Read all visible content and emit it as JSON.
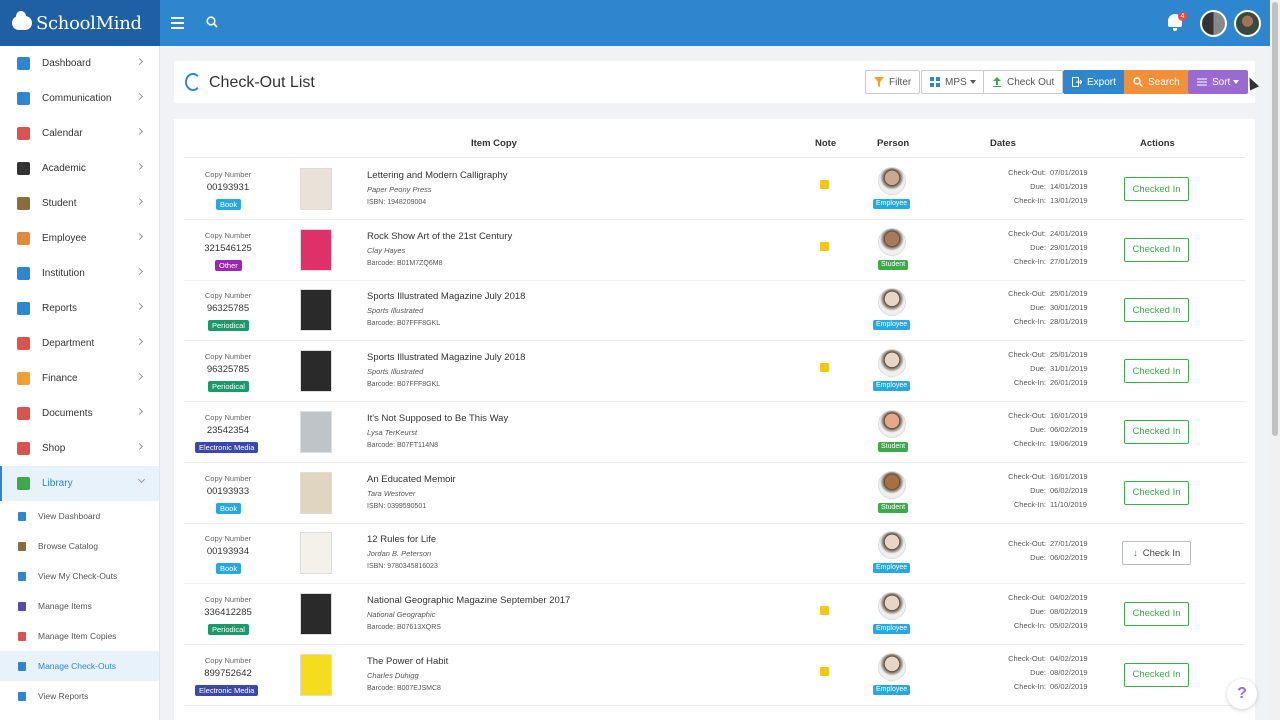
{
  "app": {
    "name": "SchoolMind",
    "notification_count": "4"
  },
  "sidebar": {
    "items": [
      {
        "label": "Dashboard",
        "icon": "dashboard-icon",
        "color": "#2e86cf"
      },
      {
        "label": "Communication",
        "icon": "chat-icon",
        "color": "#2e86cf"
      },
      {
        "label": "Calendar",
        "icon": "calendar-icon",
        "color": "#d9534f"
      },
      {
        "label": "Academic",
        "icon": "graduation-cap-icon",
        "color": "#333333"
      },
      {
        "label": "Student",
        "icon": "student-icon",
        "color": "#8a6d3b"
      },
      {
        "label": "Employee",
        "icon": "employee-icon",
        "color": "#e08a3a"
      },
      {
        "label": "Institution",
        "icon": "building-icon",
        "color": "#2e86cf"
      },
      {
        "label": "Reports",
        "icon": "report-icon",
        "color": "#2e86cf"
      },
      {
        "label": "Department",
        "icon": "department-icon",
        "color": "#d9534f"
      },
      {
        "label": "Finance",
        "icon": "finance-icon",
        "color": "#f0a030"
      },
      {
        "label": "Documents",
        "icon": "documents-icon",
        "color": "#d9534f"
      },
      {
        "label": "Shop",
        "icon": "shop-icon",
        "color": "#d9534f"
      },
      {
        "label": "Library",
        "icon": "library-icon",
        "color": "#3bab4a"
      }
    ],
    "library_sub": [
      {
        "label": "View Dashboard",
        "icon": "refresh-icon",
        "color": "#2e86cf"
      },
      {
        "label": "Browse Catalog",
        "icon": "catalog-icon",
        "color": "#8a6d3b"
      },
      {
        "label": "View My Check-Outs",
        "icon": "refresh-icon",
        "color": "#2e86cf"
      },
      {
        "label": "Manage Items",
        "icon": "book-icon",
        "color": "#5b4aa8"
      },
      {
        "label": "Manage Item Copies",
        "icon": "book-icon",
        "color": "#d9534f"
      },
      {
        "label": "Manage Check-Outs",
        "icon": "refresh-icon",
        "color": "#2e86cf"
      },
      {
        "label": "View Reports",
        "icon": "report-icon",
        "color": "#2e86cf"
      }
    ]
  },
  "header": {
    "title": "Check-Out List",
    "buttons": {
      "filter": "Filter",
      "mps": "MPS",
      "checkout": "Check Out",
      "export": "Export",
      "search": "Search",
      "sort": "Sort"
    }
  },
  "table": {
    "columns": {
      "item": "Item Copy",
      "note": "Note",
      "person": "Person",
      "dates": "Dates",
      "actions": "Actions"
    },
    "labels": {
      "copy_number": "Copy Number",
      "check_out": "Check-Out:",
      "due": "Due:",
      "check_in": "Check-In:"
    },
    "rows": [
      {
        "copy": "00193931",
        "type": "Book",
        "title": "Lettering and Modern Calligraphy",
        "sub": "Paper Peony Press",
        "code": "ISBN: 1948209004",
        "note": true,
        "role": "Employee",
        "out": "07/01/2019",
        "due": "14/01/2019",
        "in": "13/01/2019",
        "action": "Checked In"
      },
      {
        "copy": "321546125",
        "type": "Other",
        "title": "Rock Show Art of the 21st Century",
        "sub": "Clay Hayes",
        "code": "Barcode: B01M7ZQ6M8",
        "note": true,
        "role": "Student",
        "out": "24/01/2019",
        "due": "29/01/2019",
        "in": "27/01/2019",
        "action": "Checked In"
      },
      {
        "copy": "96325785",
        "type": "Periodical",
        "title": "Sports Illustrated Magazine July 2018",
        "sub": "Sports Illustrated",
        "code": "Barcode: B07FFF8GKL",
        "note": false,
        "role": "Employee",
        "out": "25/01/2019",
        "due": "30/01/2019",
        "in": "28/01/2019",
        "action": "Checked In"
      },
      {
        "copy": "96325785",
        "type": "Periodical",
        "title": "Sports Illustrated Magazine July 2018",
        "sub": "Sports Illustrated",
        "code": "Barcode: B07FFF8GKL",
        "note": true,
        "role": "Employee",
        "out": "25/01/2019",
        "due": "31/01/2019",
        "in": "26/01/2019",
        "action": "Checked In"
      },
      {
        "copy": "23542354",
        "type": "Electronic Media",
        "title": "It's Not Supposed to Be This Way",
        "sub": "Lysa TerKeurst",
        "code": "Barcode: B07FT114N8",
        "note": false,
        "role": "Student",
        "out": "16/01/2019",
        "due": "06/02/2019",
        "in": "19/06/2019",
        "action": "Checked In"
      },
      {
        "copy": "00193933",
        "type": "Book",
        "title": "An Educated Memoir",
        "sub": "Tara Westover",
        "code": "ISBN: 0399590501",
        "note": false,
        "role": "Student",
        "out": "16/01/2019",
        "due": "06/02/2019",
        "in": "11/10/2019",
        "action": "Checked In"
      },
      {
        "copy": "00193934",
        "type": "Book",
        "title": "12 Rules for Life",
        "sub": "Jordan B. Peterson",
        "code": "ISBN: 9780345816023",
        "note": false,
        "role": "Employee",
        "out": "27/01/2019",
        "due": "06/02/2019",
        "in": "",
        "action": "Check In"
      },
      {
        "copy": "336412285",
        "type": "Periodical",
        "title": "National Geographic Magazine September 2017",
        "sub": "National Geographic",
        "code": "Barcode: B07613XQRS",
        "note": true,
        "role": "Employee",
        "out": "04/02/2019",
        "due": "08/02/2019",
        "in": "05/02/2019",
        "action": "Checked In"
      },
      {
        "copy": "899752642",
        "type": "Electronic Media",
        "title": "The Power of Habit",
        "sub": "Charles Duhigg",
        "code": "Barcode: B007EJSMC8",
        "note": true,
        "role": "Employee",
        "out": "04/02/2019",
        "due": "08/02/2019",
        "in": "06/02/2019",
        "action": "Checked In"
      }
    ]
  },
  "help_label": "?"
}
